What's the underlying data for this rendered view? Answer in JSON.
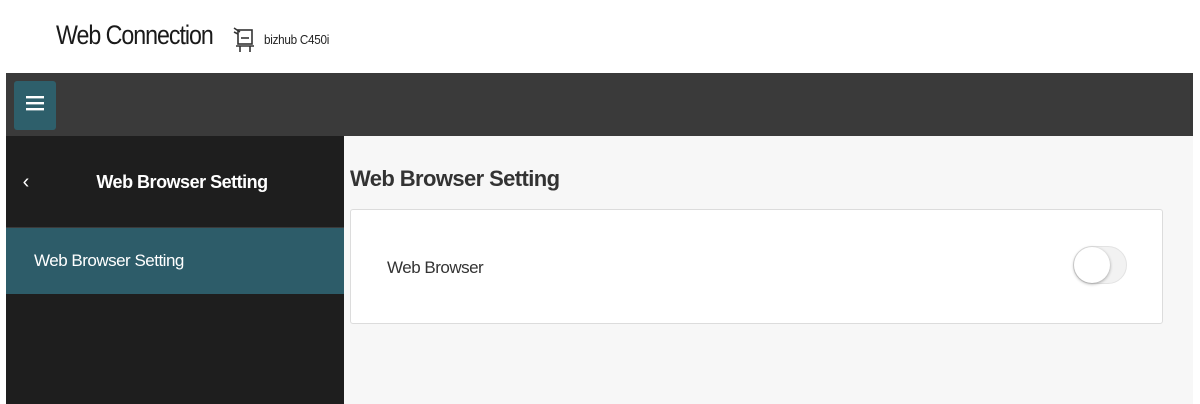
{
  "brand": {
    "title": "Web Connection",
    "device_icon": "printer-icon",
    "device_name": "bizhub C450i"
  },
  "topbar": {
    "menu_icon": "hamburger-menu-icon",
    "accent_color": "#2e5f6b"
  },
  "sidebar": {
    "back_icon": "chevron-left-icon",
    "back_glyph": "‹",
    "title": "Web Browser Setting",
    "items": [
      {
        "label": "Web Browser Setting",
        "selected": true
      }
    ]
  },
  "main": {
    "title": "Web Browser Setting",
    "settings": [
      {
        "label": "Web Browser",
        "control": "toggle",
        "enabled": false
      }
    ]
  },
  "colors": {
    "topbar_bg": "#3a3a3a",
    "sidebar_bg": "#1e1e1e",
    "selected_item_bg": "#2d5c69",
    "main_bg": "#f7f7f7"
  }
}
